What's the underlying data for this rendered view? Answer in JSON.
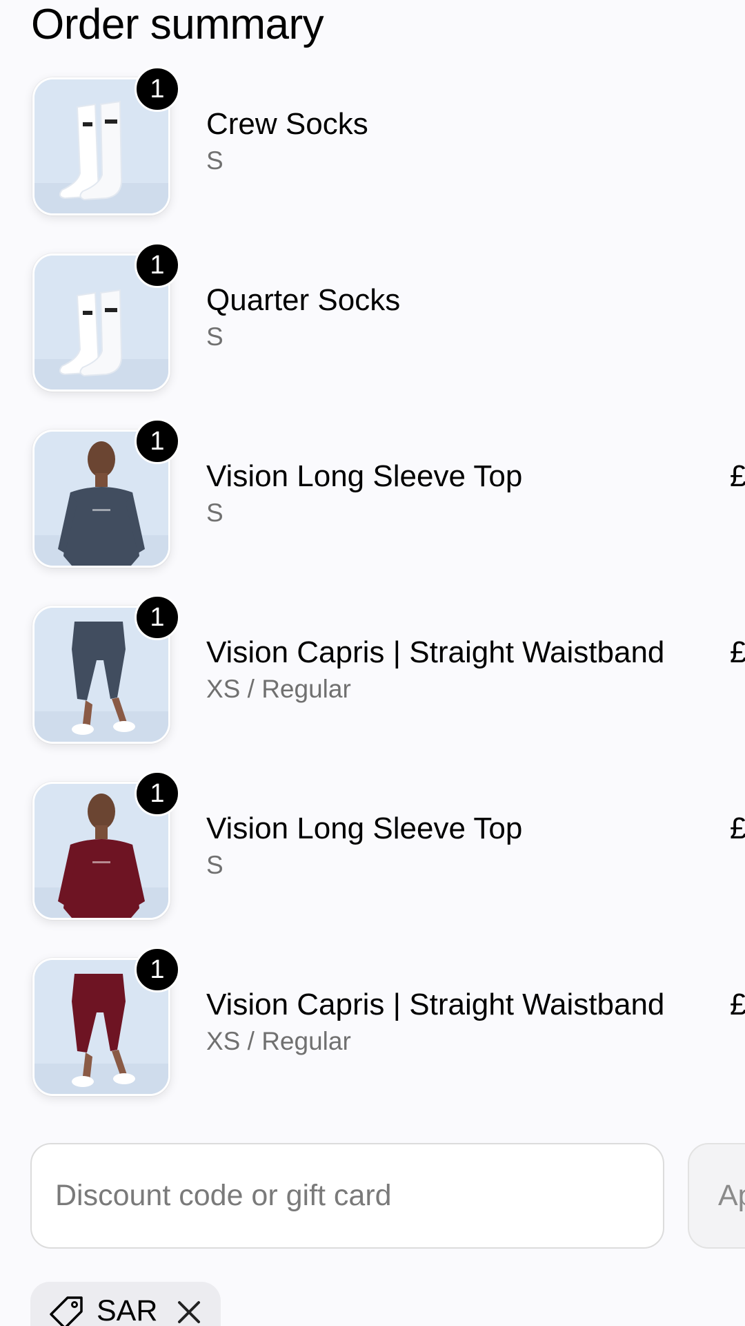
{
  "order_summary": {
    "title": "Order summary",
    "items": [
      {
        "name": "Crew Socks",
        "variant": "S",
        "quantity": "1",
        "price": "",
        "image": "white-crew-socks",
        "color": "#ffffff"
      },
      {
        "name": "Quarter Socks",
        "variant": "S",
        "quantity": "1",
        "price": "",
        "image": "white-quarter-socks",
        "color": "#ffffff"
      },
      {
        "name": "Vision Long Sleeve Top",
        "variant": "S",
        "quantity": "1",
        "price": "£",
        "image": "model-long-sleeve-top",
        "color": "#414d5f"
      },
      {
        "name": "Vision Capris | Straight Waistband",
        "variant": "XS / Regular",
        "quantity": "1",
        "price": "£",
        "image": "model-capris-leggings",
        "color": "#414d5f"
      },
      {
        "name": "Vision Long Sleeve Top",
        "variant": "S",
        "quantity": "1",
        "price": "£",
        "image": "model-long-sleeve-top",
        "color": "#6e1423"
      },
      {
        "name": "Vision Capris | Straight Waistband",
        "variant": "XS / Regular",
        "quantity": "1",
        "price": "£",
        "image": "model-capris-leggings",
        "color": "#6e1423"
      }
    ]
  },
  "discount": {
    "placeholder": "Discount code or gift card",
    "value": "",
    "apply_label": "Apply"
  },
  "applied_code": {
    "label": "SAR",
    "icon": "tag-icon",
    "remove_icon": "close-icon"
  },
  "colors": {
    "background": "#fafafd",
    "thumb_bg": "#d7e3f2",
    "badge": "#000000",
    "muted_text": "#707070"
  }
}
